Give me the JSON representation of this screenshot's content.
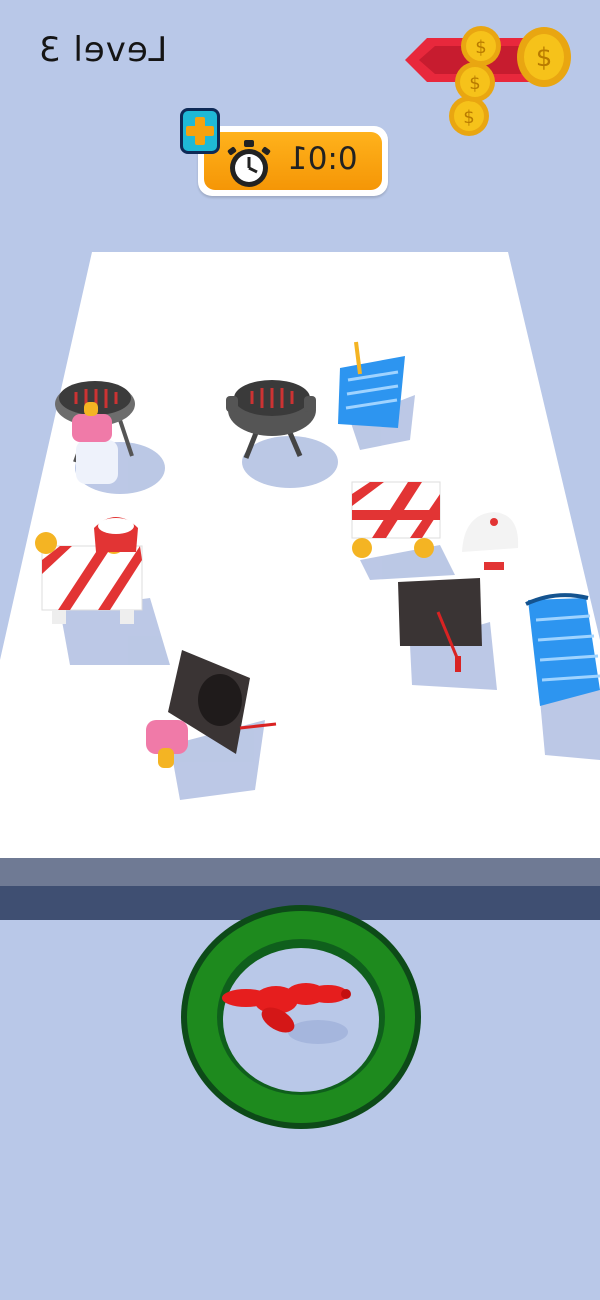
{
  "hud": {
    "level_label": "Level 3",
    "timer_value": "0:01",
    "add_time_icon": "plus-icon",
    "timer_icon": "stopwatch-icon",
    "reward_icon": "coin-icon"
  },
  "scene": {
    "board_items": [
      "barbecue-grill",
      "baby-bottle",
      "barbecue-grill",
      "shopping-basket",
      "road-barrier",
      "road-barrier",
      "santa-hat",
      "baseball-cap",
      "graduation-cap",
      "shopping-basket",
      "graduation-cap",
      "baby-bottle"
    ],
    "portal_item": "balloon-dog"
  },
  "colors": {
    "background": "#b9c8e8",
    "board": "#ffffff",
    "timer_panel": "#f9a30f",
    "portal_ring": "#1e8a1e",
    "banner": "#e8283c",
    "coin": "#f6c21a"
  }
}
